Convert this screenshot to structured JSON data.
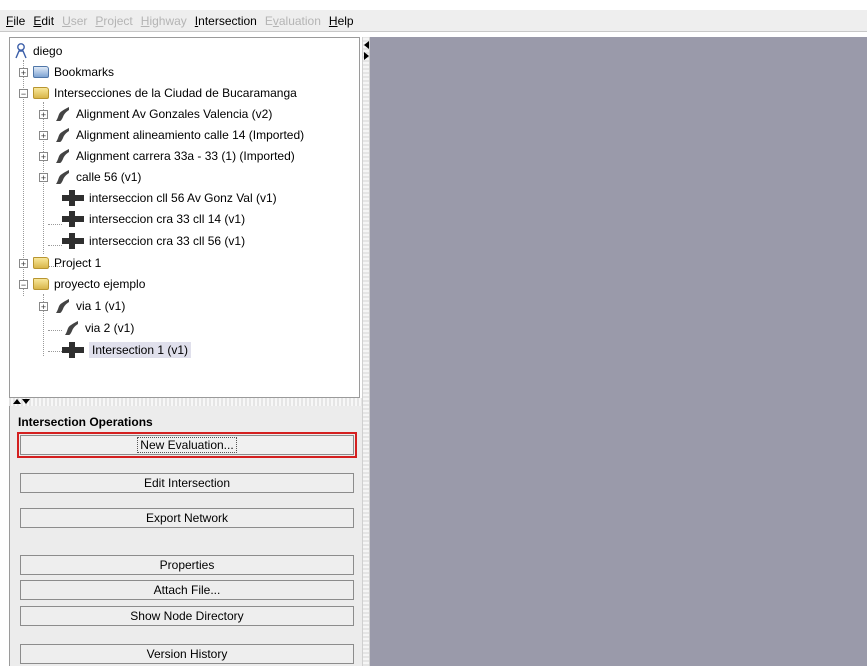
{
  "menu": [
    {
      "label": "File",
      "mnemonic": "F",
      "rest": "ile",
      "enabled": true
    },
    {
      "label": "Edit",
      "mnemonic": "E",
      "rest": "dit",
      "enabled": true
    },
    {
      "label": "User",
      "mnemonic": "U",
      "rest": "ser",
      "enabled": false
    },
    {
      "label": "Project",
      "mnemonic": "P",
      "rest": "roject",
      "enabled": false
    },
    {
      "label": "Highway",
      "mnemonic": "H",
      "rest": "ighway",
      "enabled": false
    },
    {
      "label": "Intersection",
      "mnemonic": "I",
      "rest": "ntersection",
      "enabled": true
    },
    {
      "label": "Evaluation",
      "mnemonic": "v",
      "pre": "E",
      "rest": "aluation",
      "enabled": false
    },
    {
      "label": "Help",
      "mnemonic": "H",
      "rest": "elp",
      "enabled": true
    }
  ],
  "tree": {
    "user": "diego",
    "bookmarks": "Bookmarks",
    "project_bucaramanga": "Intersecciones de la Ciudad de Bucaramanga",
    "bucaramanga_items": [
      "Alignment Av Gonzales Valencia (v2)",
      "Alignment alineamiento calle 14 (Imported)",
      "Alignment carrera 33a - 33 (1) (Imported)",
      "calle 56 (v1)",
      "interseccion cll 56 Av Gonz Val (v1)",
      "interseccion cra 33 cll 14 (v1)",
      "interseccion cra 33 cll 56 (v1)"
    ],
    "project_1": "Project 1",
    "project_ejemplo": "proyecto ejemplo",
    "ejemplo_items": [
      "via 1 (v1)",
      "via 2 (v1)",
      "Intersection 1 (v1)"
    ]
  },
  "operations": {
    "title": "Intersection Operations",
    "new_evaluation": "New Evaluation...",
    "edit_intersection": "Edit Intersection",
    "export_network": "Export Network",
    "properties": "Properties",
    "attach_file": "Attach File...",
    "show_node_directory": "Show Node Directory",
    "version_history": "Version History"
  },
  "colors": {
    "workspace": "#9a9aaa",
    "highlight": "#d42020"
  }
}
